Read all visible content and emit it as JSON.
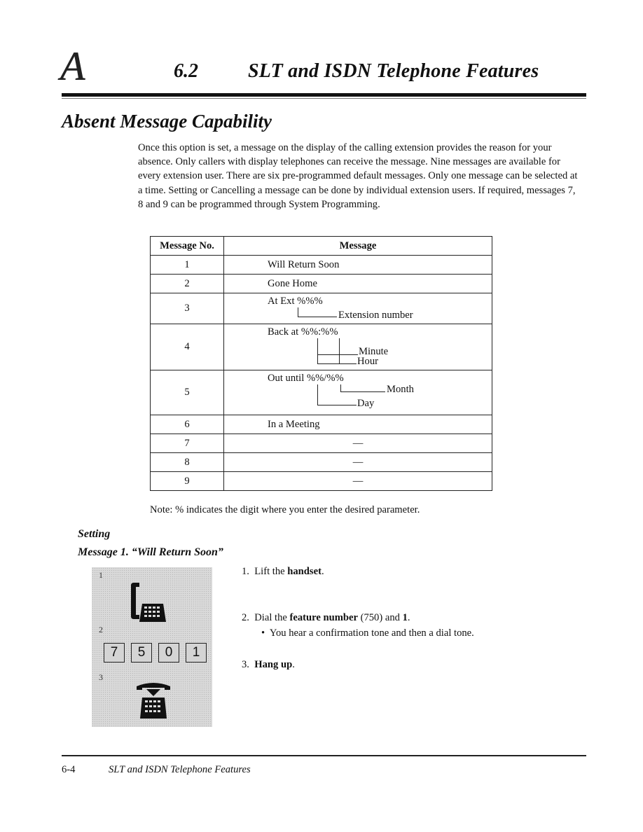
{
  "header": {
    "chapter_letter": "A",
    "section_number": "6.2",
    "section_title": "SLT and ISDN Telephone Features"
  },
  "page_heading": "Absent Message Capability",
  "intro": "Once this option is set, a message on the display of the calling extension provides the reason for your absence.  Only callers with display telephones can receive the message.  Nine messages are available for every extension user.  There are six pre-programmed default messages.  Only one message can be selected at a time.  Setting or Cancelling a message can be done by individual extension users.  If required, messages 7, 8 and 9 can be programmed through System Programming.",
  "table": {
    "headers": [
      "Message No.",
      "Message"
    ],
    "rows": [
      {
        "no": "1",
        "message": "Will Return Soon"
      },
      {
        "no": "2",
        "message": "Gone Home"
      },
      {
        "no": "3",
        "message": "At Ext %%%",
        "annotations": [
          "Extension number"
        ]
      },
      {
        "no": "4",
        "message": "Back at %%:%%",
        "annotations": [
          "Minute",
          "Hour"
        ]
      },
      {
        "no": "5",
        "message": "Out until %%/%%",
        "annotations": [
          "Month",
          "Day"
        ]
      },
      {
        "no": "6",
        "message": "In a Meeting"
      },
      {
        "no": "7",
        "message": "—"
      },
      {
        "no": "8",
        "message": "—"
      },
      {
        "no": "9",
        "message": "—"
      }
    ]
  },
  "note": "Note: % indicates the digit where you enter the desired parameter.",
  "setting": {
    "heading": "Setting",
    "subheading": "Message 1. “Will Return Soon”",
    "illustration": {
      "step_labels": [
        "1",
        "2",
        "3"
      ],
      "keys": [
        "7",
        "5",
        "0",
        "1"
      ],
      "icons": [
        "off-hook-phone-icon",
        "keypad-icon",
        "on-hook-phone-icon"
      ]
    },
    "steps": [
      {
        "num": "1.",
        "pre": "Lift the ",
        "bold": "handset",
        "post": "."
      },
      {
        "num": "2.",
        "pre": "Dial the ",
        "bold": "feature number",
        "mid": " (750) and ",
        "bold2": "1",
        "post": ".",
        "bullet": "You hear a confirmation tone and then a dial tone."
      },
      {
        "num": "3.",
        "pre": "",
        "bold": "Hang up",
        "post": "."
      }
    ]
  },
  "footer": {
    "page_number": "6-4",
    "title": "SLT and ISDN Telephone Features"
  }
}
